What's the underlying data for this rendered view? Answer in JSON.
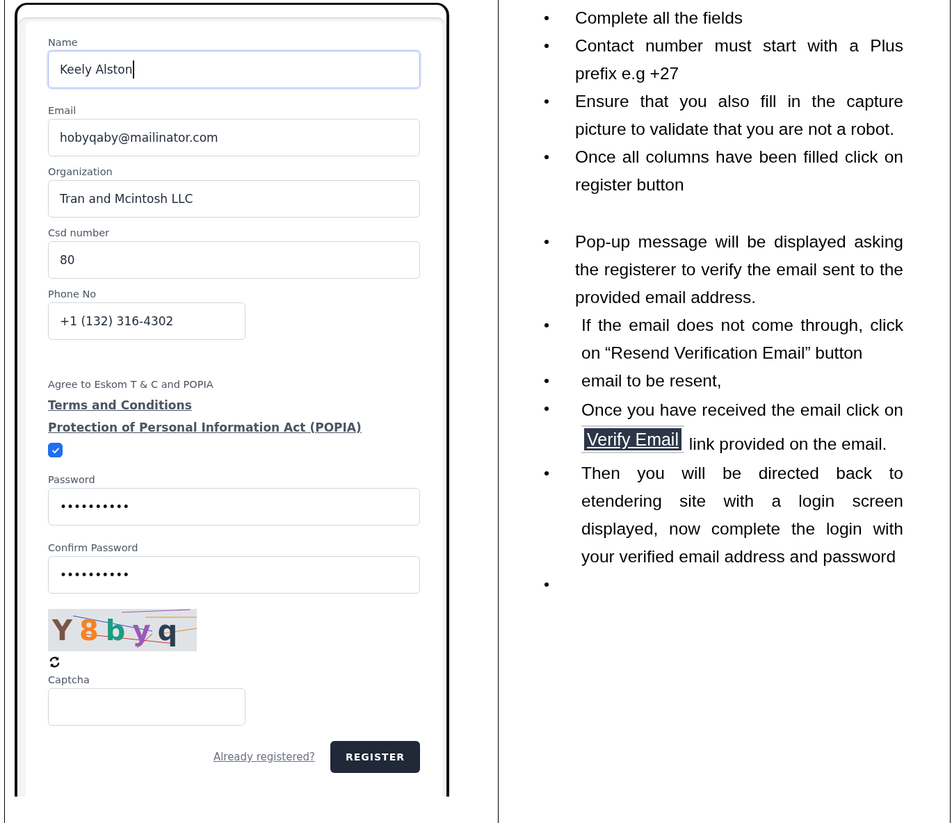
{
  "form": {
    "fields_top": [
      {
        "label": "Name",
        "value": "Keely Alston",
        "focused": true,
        "kind": "full"
      },
      {
        "label": "Email",
        "value": "hobyqaby@mailinator.com",
        "focused": false,
        "kind": "full"
      },
      {
        "label": "Organization",
        "value": "Tran and Mcintosh LLC",
        "focused": false,
        "kind": "full"
      },
      {
        "label": "Csd number",
        "value": "80",
        "focused": false,
        "kind": "full"
      },
      {
        "label": "Phone No",
        "value": "+1 (132) 316-4302",
        "focused": false,
        "kind": "short"
      }
    ],
    "agreement": {
      "label": "Agree to Eskom T & C and POPIA",
      "links": [
        "Terms and Conditions",
        "Protection of Personal Information Act (POPIA)"
      ],
      "checked": true
    },
    "fields_bottom": [
      {
        "label": "Password",
        "value": "••••••••••",
        "focused": false
      },
      {
        "label": "Confirm Password",
        "value": "••••••••••",
        "focused": false
      }
    ],
    "captcha": {
      "chars": [
        {
          "char": "Y",
          "color": "#7a5548"
        },
        {
          "char": "8",
          "color": "#f58220"
        },
        {
          "char": "b",
          "color": "#1a9e80"
        },
        {
          "char": "y",
          "color": "#9b59b6"
        },
        {
          "char": "q",
          "color": "#2c3e50"
        }
      ]
    },
    "captcha_field": {
      "label": "Captcha",
      "focused": false,
      "kind": "short"
    },
    "login_link": "Already registered?",
    "register_button": "REGISTER"
  },
  "instructions": [
    {
      "kind": "text",
      "text": "Complete all the fields"
    },
    {
      "kind": "text",
      "text": "Contact number must start with a Plus prefix e.g +27"
    },
    {
      "kind": "text",
      "text": "Ensure that you also fill in the capture picture to validate that you are not a robot."
    },
    {
      "kind": "text",
      "text": "Once all columns have been filled click on register button"
    },
    {
      "kind": "gap"
    },
    {
      "kind": "text",
      "text": "Pop-up message will be displayed asking the registerer to verify the email sent to the provided email address."
    },
    {
      "kind": "text",
      "text": "If the email does not come through, click on “Resend Verification Email” button"
    },
    {
      "kind": "text",
      "text": "email to be resent,"
    },
    {
      "kind": "button",
      "before": "Once you have received the email click on",
      "button": "Verify Email",
      "after": "link provided on the email."
    },
    {
      "kind": "text",
      "text": "Then you will be directed back to etendering site with a login screen displayed, now complete the login with your verified email address and password"
    },
    {
      "kind": "empty"
    }
  ]
}
